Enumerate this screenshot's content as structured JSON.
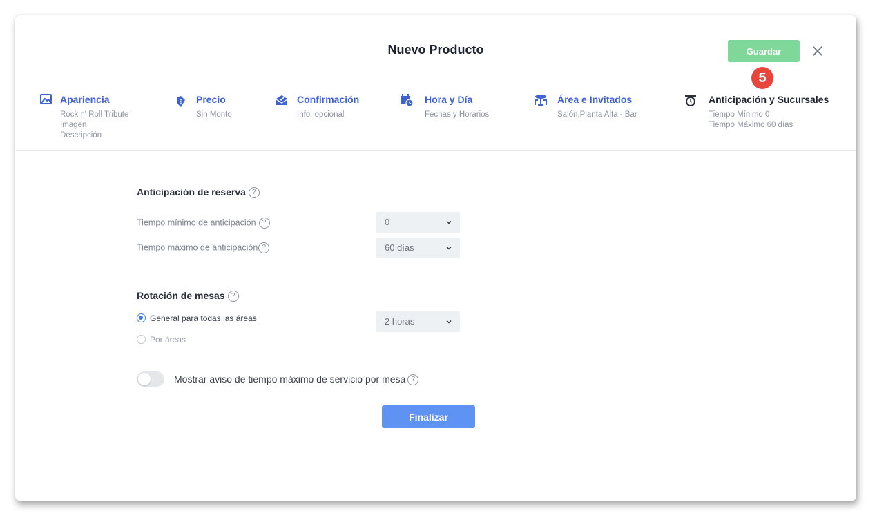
{
  "header": {
    "title": "Nuevo Producto",
    "save_label": "Guardar",
    "step_badge": "5"
  },
  "steps": [
    {
      "label": "Apariencia",
      "lines": [
        "Rock n' Roll Tribute",
        "Imagen",
        "Descripción"
      ],
      "icon": "image-icon"
    },
    {
      "label": "Precio",
      "lines": [
        "Sin Monto"
      ],
      "icon": "price-tag-icon"
    },
    {
      "label": "Confirmación",
      "lines": [
        "Info. opcional"
      ],
      "icon": "envelope-check-icon"
    },
    {
      "label": "Hora y Día",
      "lines": [
        "Fechas y Horarios"
      ],
      "icon": "calendar-clock-icon"
    },
    {
      "label": "Área e Invitados",
      "lines": [
        "Salón,Planta Alta - Bar"
      ],
      "icon": "table-chairs-icon"
    },
    {
      "label": "Anticipación y Sucursales",
      "lines": [
        "Tiempo Mínimo 0",
        "Tiempo Máximo 60 días"
      ],
      "icon": "alarm-clock-icon",
      "active": true
    }
  ],
  "advance": {
    "title": "Anticipación de reserva",
    "min_label": "Tiempo mínimo de anticipación",
    "min_value": "0",
    "max_label": "Tiempo máximo de anticipación",
    "max_value": "60 días"
  },
  "rotation": {
    "title": "Rotación de mesas",
    "option_general": "General para todas las áreas",
    "option_areas": "Por áreas",
    "selected": "general",
    "value": "2 horas"
  },
  "toggle": {
    "label": "Mostrar aviso de tiempo máximo de servicio por mesa",
    "on": false
  },
  "finish_label": "Finalizar",
  "help_glyph": "?",
  "colors": {
    "accent_blue": "#3f63d1",
    "save_green": "#7fd89a",
    "finish_blue": "#5e92f3",
    "badge_red": "#e8453c",
    "radio_blue": "#3f7be0"
  }
}
